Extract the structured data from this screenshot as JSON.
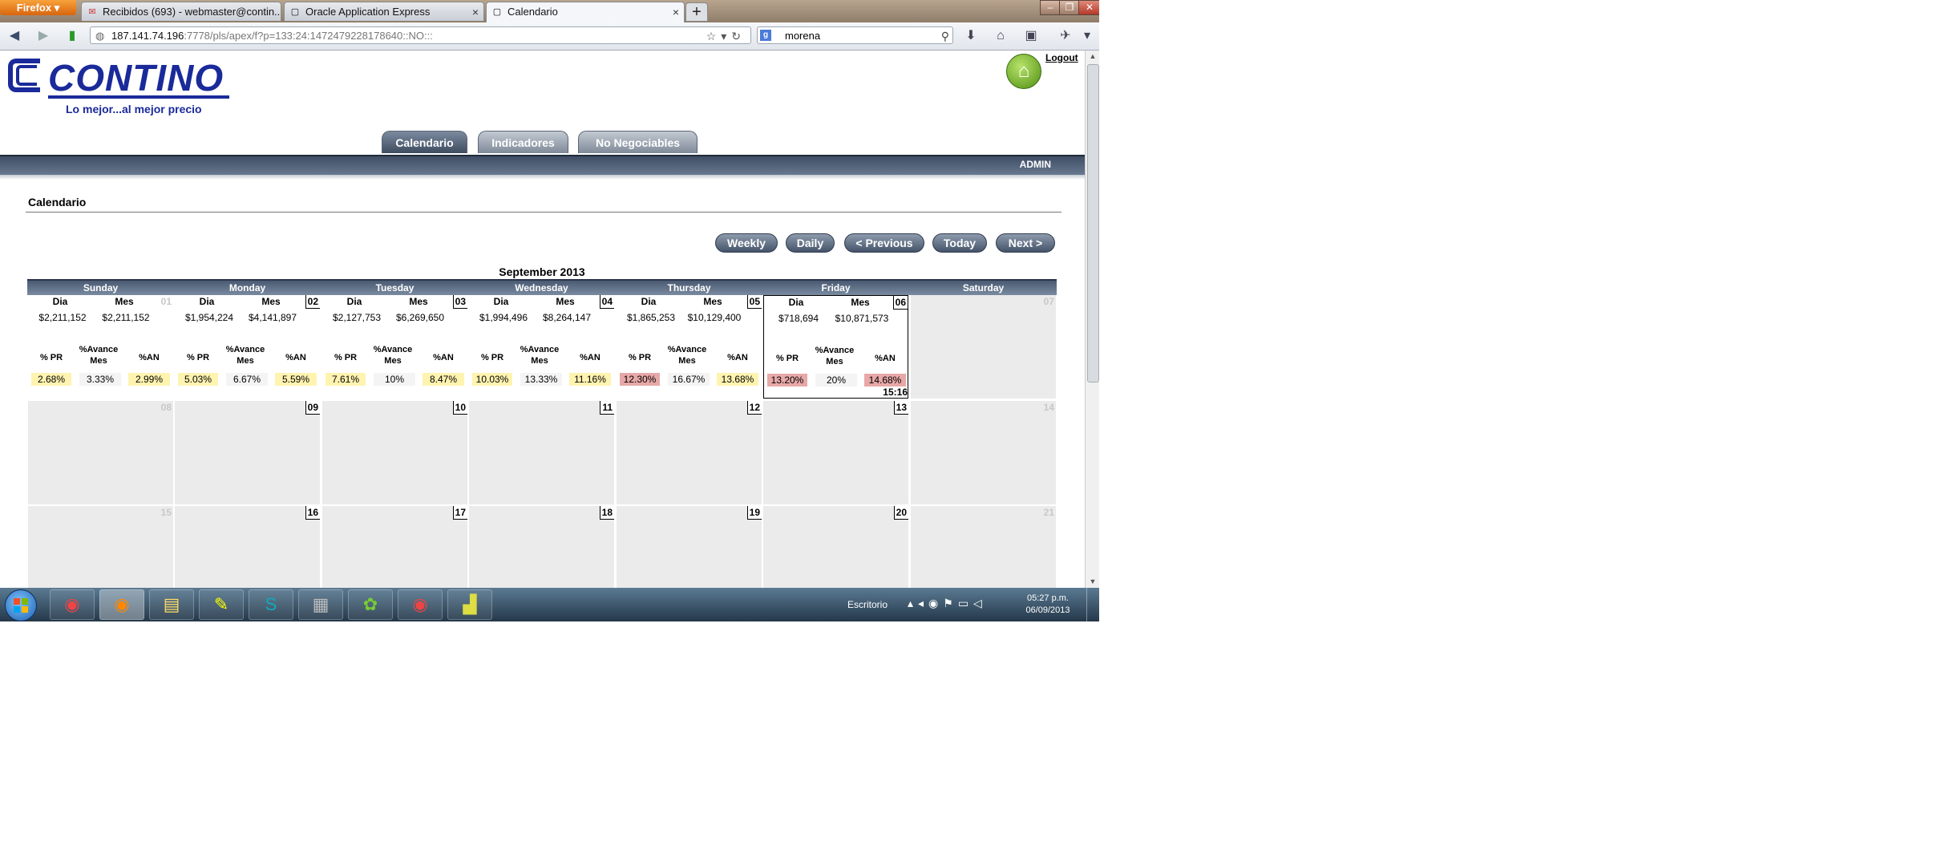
{
  "browser": {
    "menu_label": "Firefox",
    "tabs": [
      {
        "title": "Recibidos (693) - webmaster@contin...",
        "icon": "gmail-icon"
      },
      {
        "title": "Oracle Application Express",
        "icon": "page-icon"
      },
      {
        "title": "Calendario",
        "icon": "page-icon"
      }
    ],
    "new_tab": "+",
    "url_host": "187.141.74.196",
    "url_rest": ":7778/pls/apex/f?p=133:24:1472479228178640::NO:::",
    "search_value": "morena",
    "search_engine_letter": "g"
  },
  "app": {
    "logo_text": "CONTINO",
    "slogan": "Lo mejor...al mejor precio",
    "logout": "Logout",
    "tabs": [
      "Calendario",
      "Indicadores",
      "No Negociables"
    ],
    "active_tab": "Calendario",
    "user": "ADMIN",
    "region_title": "Calendario",
    "nav_buttons": [
      "Weekly",
      "Daily",
      "< Previous",
      "Today",
      "Next >"
    ]
  },
  "calendar": {
    "month": "September 2013",
    "day_names": [
      "Sunday",
      "Monday",
      "Tuesday",
      "Wednesday",
      "Thursday",
      "Friday",
      "Saturday"
    ],
    "headers": {
      "dia": "Dia",
      "mes": "Mes",
      "pr": "% PR",
      "avance_1": "%Avance",
      "avance_2": "Mes",
      "an": "%AN"
    },
    "week1": [
      {
        "num": "01",
        "out": true,
        "dia": "$2,211,152",
        "mes": "$2,211,152",
        "pr": "2.68%",
        "avance": "3.33%",
        "an": "2.99%",
        "pr_color": "yellow",
        "an_color": "yellow"
      },
      {
        "num": "02",
        "out": false,
        "dia": "$1,954,224",
        "mes": "$4,141,897",
        "pr": "5.03%",
        "avance": "6.67%",
        "an": "5.59%",
        "pr_color": "yellow",
        "an_color": "yellow"
      },
      {
        "num": "03",
        "out": false,
        "dia": "$2,127,753",
        "mes": "$6,269,650",
        "pr": "7.61%",
        "avance": "10%",
        "an": "8.47%",
        "pr_color": "yellow",
        "an_color": "yellow"
      },
      {
        "num": "04",
        "out": false,
        "dia": "$1,994,496",
        "mes": "$8,264,147",
        "pr": "10.03%",
        "avance": "13.33%",
        "an": "11.16%",
        "pr_color": "yellow",
        "an_color": "yellow"
      },
      {
        "num": "05",
        "out": false,
        "dia": "$1,865,253",
        "mes": "$10,129,400",
        "pr": "12.30%",
        "avance": "16.67%",
        "an": "13.68%",
        "pr_color": "red",
        "an_color": "yellow"
      },
      {
        "num": "06",
        "out": false,
        "today": true,
        "dia": "$718,694",
        "mes": "$10,871,573",
        "pr": "13.20%",
        "avance": "20%",
        "an": "14.68%",
        "pr_color": "red",
        "an_color": "red",
        "time": "15:16"
      },
      {
        "num": "07",
        "out": true
      }
    ],
    "week2": [
      "08",
      "09",
      "10",
      "11",
      "12",
      "13",
      "14"
    ],
    "week3": [
      "15",
      "16",
      "17",
      "18",
      "19",
      "20",
      "21"
    ]
  },
  "taskbar": {
    "tray_label": "Escritorio",
    "time": "05:27 p.m.",
    "date": "06/09/2013"
  },
  "colors": {
    "brand_blue": "#1a2a9a",
    "nav_dark": "#3f4e64",
    "highlight_yellow": "#fff3b0",
    "highlight_red": "#e8a8a8"
  }
}
